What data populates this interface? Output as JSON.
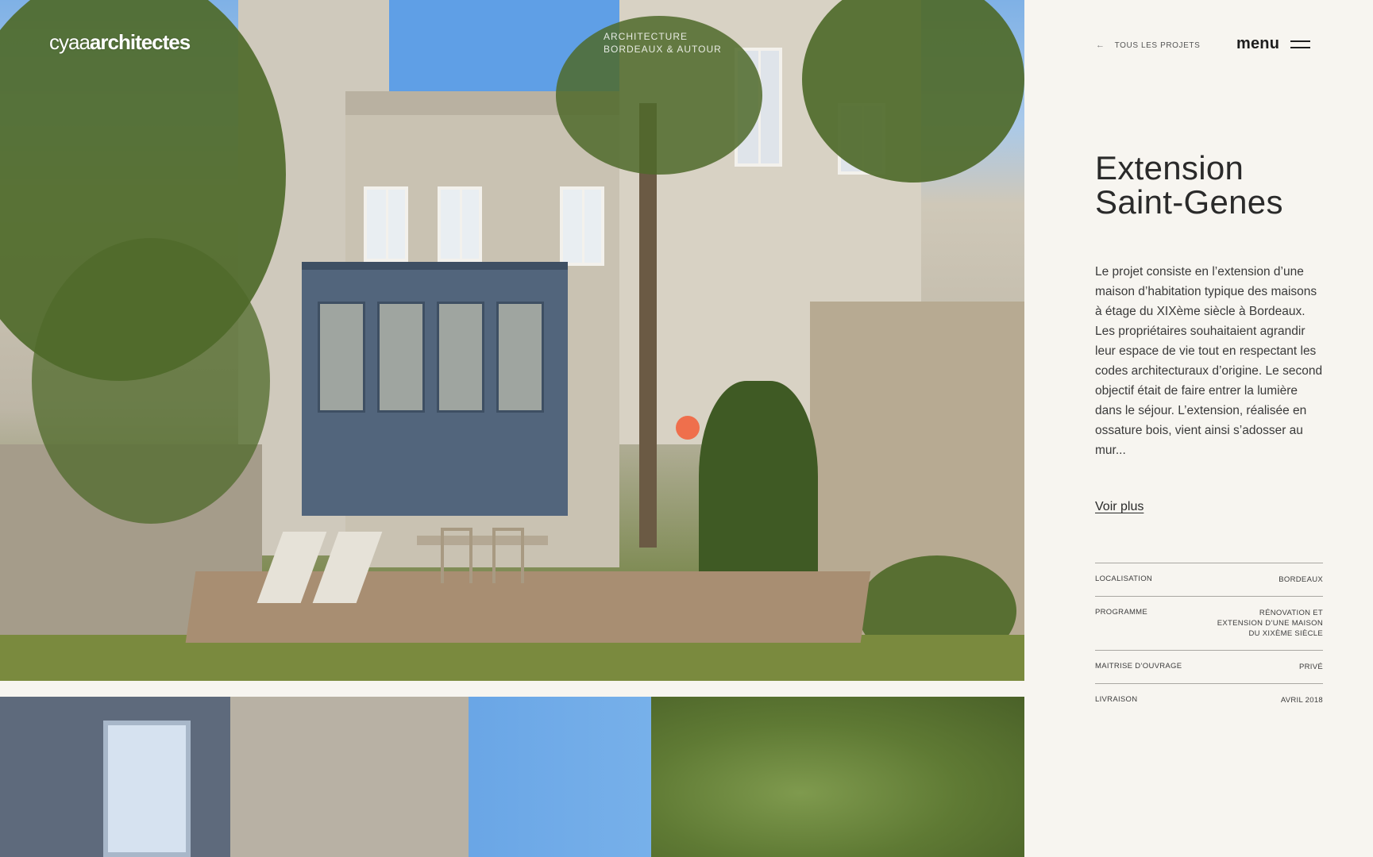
{
  "brand": {
    "logo_thin": "cyaa",
    "logo_bold": "architectes",
    "tagline_line1": "ARCHITECTURE",
    "tagline_line2": "BORDEAUX & AUTOUR"
  },
  "nav": {
    "back_label": "TOUS LES PROJETS",
    "back_arrow": "←",
    "menu_label": "menu"
  },
  "project": {
    "title_line1": "Extension",
    "title_line2": "Saint-Genes",
    "description": [
      "Le projet consiste en l’extension d’une maison d’habitation typique des maisons à étage du XIXème siècle à Bordeaux.",
      "Les propriétaires souhaitaient agrandir leur espace de vie tout en respectant les codes architecturaux d’origine. Le second objectif était de faire entrer la lumière dans le séjour. L’extension, réalisée en ossature bois, vient ainsi s’adosser au mur..."
    ],
    "voir_plus": "Voir plus",
    "specs": [
      {
        "key": "LOCALISATION",
        "value": "BORDEAUX"
      },
      {
        "key": "PROGRAMME",
        "value_lines": [
          "RÉNOVATION ET",
          "EXTENSION D’UNE MAISON",
          "DU XIXÈME SIÈCLE"
        ]
      },
      {
        "key": "MAITRISE D’OUVRAGE",
        "value": "PRIVÉ"
      },
      {
        "key": "LIVRAISON",
        "value": "AVRIL 2018"
      }
    ]
  },
  "colors": {
    "accent_dot": "#ef6f4c",
    "sidebar_bg": "#f7f5f0",
    "text": "#2a2a2a"
  },
  "icons": {
    "back": "arrow-left-icon",
    "menu": "hamburger-icon"
  }
}
